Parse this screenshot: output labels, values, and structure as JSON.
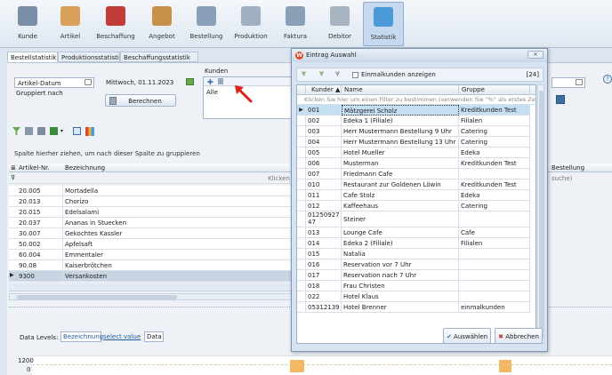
{
  "ribbon": [
    {
      "label": "Kunde",
      "icon": "customer-icon",
      "color": "#7a8ea8"
    },
    {
      "label": "Artikel",
      "icon": "bread-icon",
      "color": "#d8a058"
    },
    {
      "label": "Beschaffung",
      "icon": "basket-icon",
      "color": "#c23b3b"
    },
    {
      "label": "Angebot",
      "icon": "handshake-icon",
      "color": "#c89048"
    },
    {
      "label": "Bestellung",
      "icon": "order-document-icon",
      "color": "#8aa0b8"
    },
    {
      "label": "Produktion",
      "icon": "production-icon",
      "color": "#9fb0c2"
    },
    {
      "label": "Faktura",
      "icon": "invoice-icon",
      "color": "#8aa0b8"
    },
    {
      "label": "Debitor",
      "icon": "debitor-icon",
      "color": "#a8b4c2"
    },
    {
      "label": "Statistik",
      "icon": "statistics-icon",
      "color": "#4a9ad8"
    }
  ],
  "tabs": [
    "Bestellstatistik",
    "Produktionsstatistik",
    "Beschaffungsstatistik"
  ],
  "filters": {
    "artikel_datum": "Artikel-Datum",
    "gruppiert_nach": "Gruppiert nach",
    "date": "Mittwoch, 01.11.2023",
    "kunden_label": "Kunden",
    "kunden_value": "Alle",
    "berechnen": "Berechnen"
  },
  "main_grid": {
    "group_hint": "Spalte hierher ziehen, um nach dieser Spalte zu gruppieren",
    "col_artikel": "Artikel-Nr.",
    "col_bezeichnung": "Bezeichnung",
    "col_bestellung": "Bestellung",
    "filter_hint_left": "Klicken",
    "filter_hint_right": "suche)",
    "rows": [
      {
        "nr": "20.005",
        "name": "Mortadella"
      },
      {
        "nr": "20.013",
        "name": "Chorizo"
      },
      {
        "nr": "20.015",
        "name": "Edelsalami"
      },
      {
        "nr": "20.037",
        "name": "Ananas in Stuecken"
      },
      {
        "nr": "30.007",
        "name": "Gekochtes Kassler"
      },
      {
        "nr": "50.002",
        "name": "Apfelsaft"
      },
      {
        "nr": "60.004",
        "name": "Emmentaler"
      },
      {
        "nr": "90.08",
        "name": "Kaiserbrötchen"
      },
      {
        "nr": "9300",
        "name": "Versankosten"
      }
    ]
  },
  "data_levels": {
    "label": "Data Levels:",
    "bezeichnung": "Bezeichnung",
    "select_value": "select value",
    "data": "Data"
  },
  "chart_axis": {
    "top": "1200",
    "bottom": "0"
  },
  "dialog": {
    "title": "Eintrag Auswahl",
    "checkbox_label": "Einmalkunden anzeigen",
    "count": "[24]",
    "col_kunder": "Kunder",
    "col_name": "Name",
    "col_gruppe": "Gruppe",
    "filter_hint": "Klicken Sie hier um einen Filter zu bestimmen (verwenden Sie \"%\" als erstes Zei",
    "rows": [
      {
        "k": "001",
        "n": "Mätzgerei Scholz",
        "g": "Kreditkunden Test"
      },
      {
        "k": "002",
        "n": "Edeka 1 (Filiale)",
        "g": "Filialen"
      },
      {
        "k": "003",
        "n": "Herr Mustermann Bestellung 9 Uhr",
        "g": "Catering"
      },
      {
        "k": "004",
        "n": "Herr Mustermann Bestellung 13 Uhr",
        "g": "Catering"
      },
      {
        "k": "005",
        "n": "Hotel Mueller",
        "g": "Edeka"
      },
      {
        "k": "006",
        "n": "Musterman",
        "g": "Kreditkunden Test"
      },
      {
        "k": "007",
        "n": "Friedmann Cafe",
        "g": ""
      },
      {
        "k": "010",
        "n": "Restaurant zur Goldenen Löwin",
        "g": "Kreditkunden Test"
      },
      {
        "k": "011",
        "n": "Cafe Stolz",
        "g": "Edeka"
      },
      {
        "k": "012",
        "n": "Kaffeehaus",
        "g": "Catering"
      },
      {
        "k": "0125092747",
        "n": "Steiner",
        "g": ""
      },
      {
        "k": "013",
        "n": "Lounge Cafe",
        "g": "Cafe"
      },
      {
        "k": "014",
        "n": "Edeka 2 (Filiale)",
        "g": "Filialen"
      },
      {
        "k": "015",
        "n": "Natalia",
        "g": ""
      },
      {
        "k": "016",
        "n": "Reservation vor 7 Uhr",
        "g": ""
      },
      {
        "k": "017",
        "n": "Reservation nach 7 Uhr",
        "g": ""
      },
      {
        "k": "018",
        "n": "Frau Christen",
        "g": ""
      },
      {
        "k": "022",
        "n": "Hotel Klaus",
        "g": ""
      },
      {
        "k": "053121394",
        "n": "Hotel Brenner",
        "g": "einmalkunden"
      }
    ],
    "btn_ok": "Auswählen",
    "btn_cancel": "Abbrechen"
  }
}
